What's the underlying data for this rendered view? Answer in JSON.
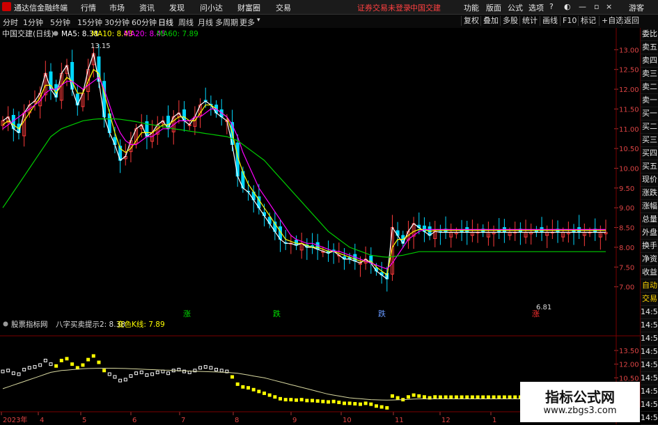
{
  "app": {
    "title": "通达信金融终端"
  },
  "menu": {
    "items": [
      "行情",
      "市场",
      "资讯",
      "发现",
      "问小达",
      "财富圈",
      "交易"
    ],
    "notice": "证券交易未登录",
    "stock": "中国交建",
    "right": [
      "功能",
      "版面",
      "公式",
      "选项"
    ],
    "user": "游客"
  },
  "toolbar": {
    "periods": [
      "分时",
      "1分钟",
      "5分钟",
      "15分钟",
      "30分钟",
      "60分钟",
      "日线",
      "周线",
      "月线",
      "多周期",
      "更多"
    ],
    "active": "日线",
    "right": [
      "复权",
      "叠加",
      "多股",
      "统计",
      "画线",
      "F10",
      "标记",
      "+自选",
      "返回"
    ]
  },
  "main_chart": {
    "title": "中国交建(日线)",
    "ma_labels": [
      "MA5: 8.38",
      "MA10: 8.43",
      "MA20: 8.45",
      "MA60: 7.89"
    ],
    "ma_colors": [
      "#ffffff",
      "#ffff00",
      "#ff00ff",
      "#00cc00"
    ],
    "high_label": "13.15",
    "low_label": "6.81",
    "signals": [
      {
        "text": "涨",
        "color": "#00dd00"
      },
      {
        "text": "跌",
        "color": "#00dd00"
      },
      {
        "text": "跌",
        "color": "#6699ff"
      },
      {
        "text": "涨",
        "color": "#ff3030"
      }
    ]
  },
  "indicator": {
    "name": "股票指标网",
    "title": "八字买卖提示2: 8.38",
    "line_label": "变色K线: 7.89"
  },
  "x_axis": [
    "2023年",
    "4",
    "5",
    "6",
    "7",
    "8",
    "9",
    "10",
    "11",
    "12",
    "1"
  ],
  "sidebar": {
    "items": [
      "委比",
      "卖五",
      "卖四",
      "卖三",
      "卖二",
      "卖一",
      "买一",
      "买二",
      "买三",
      "买四",
      "买五",
      "现价",
      "涨跌",
      "涨幅",
      "总量",
      "外盘",
      "换手",
      "净资",
      "收益",
      "自动",
      "交易",
      "14:56",
      "14:56",
      "14:56",
      "14:56",
      "14:56",
      "14:56",
      "14:56",
      "14:56",
      "14:56"
    ],
    "badge": "L"
  },
  "watermark": {
    "title": "指标公式网",
    "url": "www.zbgs3.com"
  },
  "chart_data": {
    "type": "line",
    "title": "中国交建(日线)",
    "xlabel": "",
    "ylabel": "",
    "ylim": [
      6.5,
      13.2
    ],
    "y_ticks": [
      13.0,
      12.5,
      12.0,
      11.5,
      11.0,
      10.5,
      10.0,
      9.5,
      9.0,
      8.5,
      8.0,
      7.5,
      7.0
    ],
    "indicator_ticks": [
      13.5,
      12.0,
      10.5,
      9.0
    ],
    "x": [
      0,
      2,
      4,
      6,
      8,
      10,
      12,
      14,
      16,
      18,
      20,
      22,
      24,
      26,
      28,
      30,
      32,
      34,
      36,
      38,
      40,
      42,
      44,
      46,
      48,
      50,
      52,
      54,
      56,
      58,
      60,
      62,
      64,
      66,
      68,
      70,
      72,
      74,
      76,
      78,
      80,
      82,
      84,
      86,
      88,
      90,
      92,
      94,
      96,
      98,
      100,
      102,
      104,
      106,
      108,
      110,
      112,
      114,
      116,
      118,
      120,
      122,
      124,
      126,
      128,
      130,
      132,
      134,
      136,
      138,
      140,
      142,
      144,
      146,
      148,
      150,
      152,
      154,
      156,
      158,
      160,
      162,
      164,
      166,
      168,
      170,
      172,
      174,
      176,
      178,
      180,
      182,
      184,
      186,
      188,
      190,
      192,
      194,
      196,
      198,
      200,
      202,
      204,
      206,
      208,
      210,
      212,
      214,
      216,
      218,
      220,
      222,
      224,
      226
    ],
    "series": [
      {
        "name": "MA5",
        "values": [
          11.2,
          11.3,
          11.0,
          10.9,
          11.4,
          11.6,
          11.7,
          11.9,
          12.4,
          12.0,
          11.8,
          12.4,
          12.6,
          12.0,
          11.6,
          11.9,
          12.5,
          12.9,
          12.2,
          11.3,
          10.9,
          10.6,
          10.2,
          10.3,
          10.7,
          11.0,
          11.1,
          10.8,
          10.9,
          11.1,
          11.2,
          11.0,
          11.3,
          11.4,
          11.2,
          11.1,
          11.3,
          11.6,
          11.7,
          11.6,
          11.4,
          11.3,
          11.2,
          10.6,
          9.8,
          9.5,
          9.4,
          9.2,
          9.0,
          8.8,
          8.6,
          8.4,
          8.2,
          8.1,
          8.1,
          8.05,
          8.1,
          8.0,
          8.0,
          7.95,
          7.9,
          7.85,
          7.9,
          7.8,
          7.7,
          7.7,
          7.65,
          7.6,
          7.7,
          7.6,
          7.4,
          7.3,
          7.2,
          8.5,
          8.3,
          8.1,
          8.4,
          8.6,
          8.5,
          8.4,
          8.3,
          8.4,
          8.38,
          8.38,
          8.38,
          8.38,
          8.38,
          8.38,
          8.38,
          8.38,
          8.38,
          8.38,
          8.38,
          8.38,
          8.38,
          8.38,
          8.38,
          8.38,
          8.38,
          8.38,
          8.38,
          8.38,
          8.38,
          8.38,
          8.38,
          8.38,
          8.38,
          8.38,
          8.38,
          8.38,
          8.38,
          8.38,
          8.38,
          8.38
        ]
      },
      {
        "name": "MA10",
        "values": [
          11.1,
          11.2,
          11.1,
          11.0,
          11.2,
          11.4,
          11.6,
          11.8,
          12.1,
          12.1,
          11.9,
          12.1,
          12.3,
          12.2,
          11.9,
          11.9,
          12.2,
          12.5,
          12.4,
          11.9,
          11.4,
          10.9,
          10.5,
          10.4,
          10.5,
          10.7,
          10.9,
          10.9,
          10.9,
          11.0,
          11.1,
          11.1,
          11.2,
          11.3,
          11.3,
          11.2,
          11.2,
          11.4,
          11.6,
          11.6,
          11.5,
          11.4,
          11.3,
          10.9,
          10.3,
          9.9,
          9.6,
          9.4,
          9.2,
          9.0,
          8.8,
          8.6,
          8.4,
          8.2,
          8.15,
          8.1,
          8.1,
          8.05,
          8.0,
          8.0,
          7.95,
          7.9,
          7.9,
          7.85,
          7.8,
          7.75,
          7.7,
          7.65,
          7.65,
          7.65,
          7.5,
          7.4,
          7.3,
          8.0,
          8.2,
          8.2,
          8.3,
          8.4,
          8.45,
          8.45,
          8.4,
          8.43,
          8.43,
          8.43,
          8.43,
          8.43,
          8.43,
          8.43,
          8.43,
          8.43,
          8.43,
          8.43,
          8.43,
          8.43,
          8.43,
          8.43,
          8.43,
          8.43,
          8.43,
          8.43,
          8.43,
          8.43,
          8.43,
          8.43,
          8.43,
          8.43,
          8.43,
          8.43,
          8.43,
          8.43,
          8.43,
          8.43,
          8.43,
          8.43
        ]
      },
      {
        "name": "MA20",
        "values": [
          11.0,
          11.1,
          11.2,
          11.3,
          11.4,
          11.5,
          11.6,
          11.7,
          11.9,
          12.0,
          12.0,
          12.1,
          12.2,
          12.2,
          12.1,
          12.0,
          12.1,
          12.2,
          12.3,
          12.0,
          11.6,
          11.2,
          10.9,
          10.7,
          10.6,
          10.6,
          10.7,
          10.8,
          10.8,
          10.9,
          11.0,
          11.0,
          11.1,
          11.2,
          11.2,
          11.2,
          11.3,
          11.3,
          11.4,
          11.5,
          11.5,
          11.4,
          11.3,
          11.1,
          10.8,
          10.4,
          10.1,
          9.8,
          9.5,
          9.3,
          9.1,
          8.9,
          8.7,
          8.5,
          8.3,
          8.2,
          8.15,
          8.1,
          8.1,
          8.05,
          8.0,
          7.95,
          7.9,
          7.9,
          7.85,
          7.8,
          7.75,
          7.7,
          7.65,
          7.6,
          7.55,
          7.5,
          7.45,
          7.6,
          7.8,
          8.0,
          8.2,
          8.3,
          8.4,
          8.45,
          8.45,
          8.45,
          8.45,
          8.45,
          8.45,
          8.45,
          8.45,
          8.45,
          8.45,
          8.45,
          8.45,
          8.45,
          8.45,
          8.45,
          8.45,
          8.45,
          8.45,
          8.45,
          8.45,
          8.45,
          8.45,
          8.45,
          8.45,
          8.45,
          8.45,
          8.45,
          8.45,
          8.45,
          8.45,
          8.45,
          8.45,
          8.45,
          8.45,
          8.45
        ]
      },
      {
        "name": "MA60",
        "values": [
          9.0,
          9.2,
          9.4,
          9.6,
          9.8,
          10.0,
          10.2,
          10.4,
          10.6,
          10.8,
          10.9,
          11.0,
          11.05,
          11.1,
          11.15,
          11.2,
          11.22,
          11.24,
          11.25,
          11.25,
          11.25,
          11.25,
          11.24,
          11.22,
          11.2,
          11.18,
          11.15,
          11.12,
          11.1,
          11.08,
          11.05,
          11.03,
          11.0,
          10.98,
          10.96,
          10.94,
          10.92,
          10.9,
          10.88,
          10.86,
          10.84,
          10.82,
          10.8,
          10.75,
          10.7,
          10.6,
          10.5,
          10.4,
          10.3,
          10.2,
          10.05,
          9.9,
          9.75,
          9.6,
          9.45,
          9.3,
          9.15,
          9.0,
          8.85,
          8.7,
          8.55,
          8.4,
          8.3,
          8.2,
          8.1,
          8.0,
          7.95,
          7.9,
          7.85,
          7.8,
          7.78,
          7.76,
          7.75,
          7.76,
          7.78,
          7.8,
          7.83,
          7.86,
          7.89,
          7.89,
          7.89,
          7.89,
          7.89,
          7.89,
          7.89,
          7.89,
          7.89,
          7.89,
          7.89,
          7.89,
          7.89,
          7.89,
          7.89,
          7.89,
          7.89,
          7.89,
          7.89,
          7.89,
          7.89,
          7.89,
          7.89,
          7.89,
          7.89,
          7.89,
          7.89,
          7.89,
          7.89,
          7.89,
          7.89,
          7.89,
          7.89,
          7.89,
          7.89,
          7.89
        ]
      }
    ]
  }
}
